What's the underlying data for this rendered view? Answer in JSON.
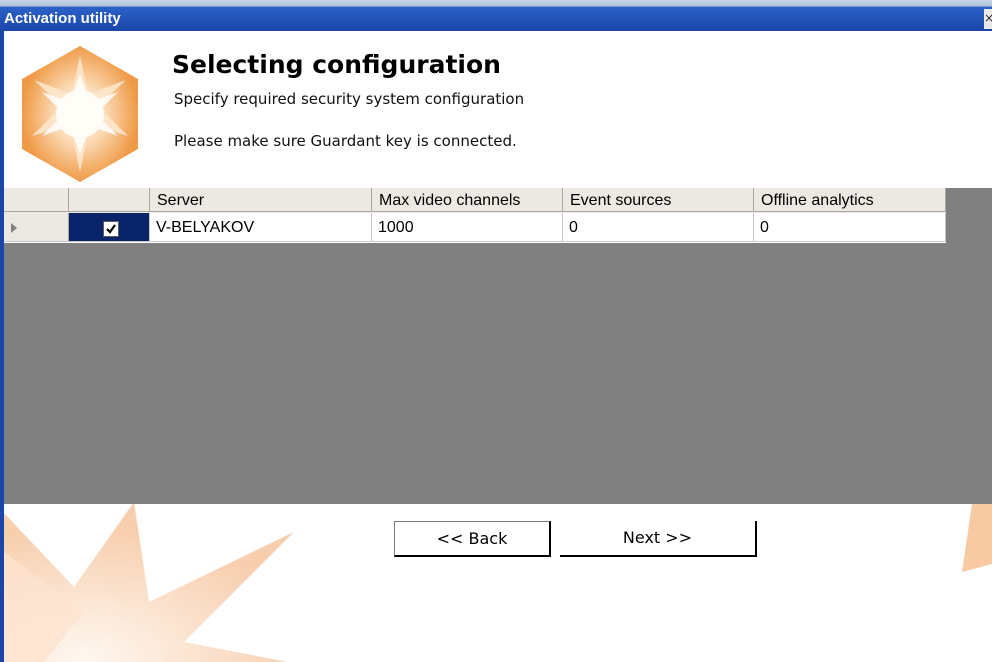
{
  "window": {
    "title": "Activation utility",
    "close_glyph": "×"
  },
  "header": {
    "title": "Selecting configuration",
    "subtitle": "Specify required security system configuration",
    "note": "Please make sure Guardant key is connected."
  },
  "grid": {
    "columns": [
      "",
      "",
      "Server",
      "Max video channels",
      "Event sources",
      "Offline analytics"
    ],
    "rows": [
      {
        "selected": true,
        "checked": true,
        "server": "V-BELYAKOV",
        "max_video_channels": "1000",
        "event_sources": "0",
        "offline_analytics": "0"
      }
    ]
  },
  "buttons": {
    "back": "<< Back",
    "next": "Next >>"
  },
  "icons": {
    "logo": "hexagon-star-logo-icon",
    "row_pointer": "row-pointer-icon",
    "checkbox": "check-icon"
  },
  "colors": {
    "title_bar": "#1a46a8",
    "accent_orange": "#f0a45d",
    "grid_background": "#808080",
    "selection": "#0a246a"
  }
}
